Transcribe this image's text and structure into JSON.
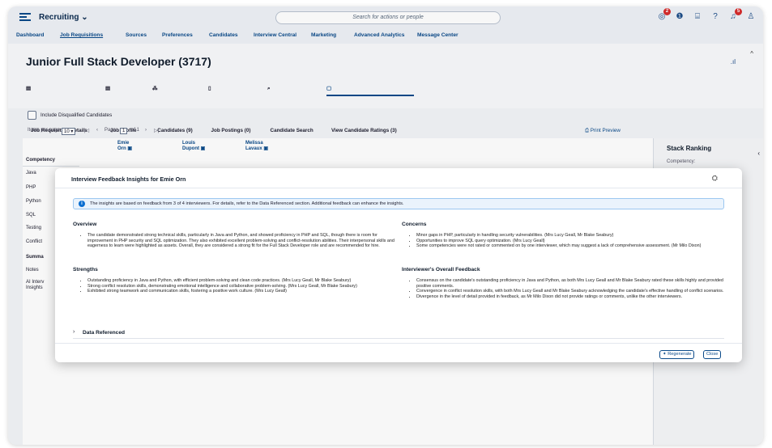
{
  "shell": {
    "app_title": "Recruiting",
    "app_title_chevron": "⌄",
    "search_placeholder": "Search for actions or people",
    "notifications_badge": "2",
    "alerts_badge": "5"
  },
  "topnav": {
    "items": [
      "Dashboard",
      "Job Requisitions",
      "Sources",
      "Preferences",
      "Candidates",
      "Interview Central",
      "Marketing",
      "Advanced Analytics",
      "Message Center"
    ]
  },
  "page": {
    "title": "Junior Full Stack Developer (3717)",
    "tabs": [
      "Job Requisition Details",
      "Job Profile",
      "Candidates (9)",
      "Job Postings (0)",
      "Candidate Search",
      "View Candidate Ratings (3)"
    ]
  },
  "filters": {
    "include_disqualified": "Include Disqualified Candidates",
    "items_per_page_label": "Items per page",
    "items_per_page_value": "10",
    "page_label": "Page",
    "page_value": "1",
    "page_of": "of 1",
    "print_preview": "Print Preview"
  },
  "table": {
    "candidates": [
      {
        "first": "Emie",
        "last": "Orn"
      },
      {
        "first": "Louis",
        "last": "Dupont"
      },
      {
        "first": "Melissa",
        "last": "Lavaux"
      }
    ],
    "competency_header": "Competency",
    "rows": [
      "Java",
      "PHP",
      "Python",
      "SQL",
      "Testing",
      "Conflict"
    ],
    "summary_header": "Summa",
    "notes_row": "Notes",
    "ai_row_line1": "AI Interv",
    "ai_row_line2": "Insights"
  },
  "stack_ranking": {
    "title": "Stack Ranking",
    "competency_label": "Competency:"
  },
  "dialog": {
    "title": "Interview Feedback Insights for Emie Orn",
    "info": "The insights are based on feedback from 3 of 4 interviewers. For details, refer to the Data Referenced section. Additional feedback can enhance the insights.",
    "overview_title": "Overview",
    "overview": [
      "The candidate demonstrated strong technical skills, particularly in Java and Python, and showed proficiency in PHP and SQL, though there is room for improvement in PHP security and SQL optimization. They also exhibited excellent problem-solving and conflict-resolution abilities. Their interpersonal skills and eagerness to learn were highlighted as assets. Overall, they are considered a strong fit for the Full Stack Developer role and are recommended for hire."
    ],
    "strengths_title": "Strengths",
    "strengths": [
      "Outstanding proficiency in Java and Python, with efficient problem-solving and clean code practices. (Mrs Lucy Geall, Mr Blake Seabury)",
      "Strong conflict resolution skills, demonstrating emotional intelligence and collaborative problem-solving. (Mrs Lucy Geall, Mr Blake Seabury)",
      "Exhibited strong teamwork and communication skills, fostering a positive work culture. (Mrs Lucy Geall)"
    ],
    "concerns_title": "Concerns",
    "concerns": [
      "Minor gaps in PHP, particularly in handling security vulnerabilities. (Mrs Lucy Geall, Mr Blake Seabury)",
      "Opportunities to improve SQL query optimization. (Mrs Lucy Geall)",
      "Some competencies were not rated or commented on by one interviewer, which may suggest a lack of comprehensive assessment. (Mr Milo Dixon)"
    ],
    "overall_title": "Interviewer's Overall Feedback",
    "overall": [
      "Consensus on the candidate's outstanding proficiency in Java and Python, as both Mrs Lucy Geall and Mr Blake Seabury rated these skills highly and provided positive comments.",
      "Convergence in conflict resolution skills, with both Mrs Lucy Geall and Mr Blake Seabury acknowledging the candidate's effective handling of conflict scenarios.",
      "Divergence in the level of detail provided in feedback, as Mr Milo Dixon did not provide ratings or comments, unlike the other interviewers."
    ],
    "data_referenced": "Data Referenced",
    "regenerate": "Regenerate",
    "close": "Close"
  }
}
